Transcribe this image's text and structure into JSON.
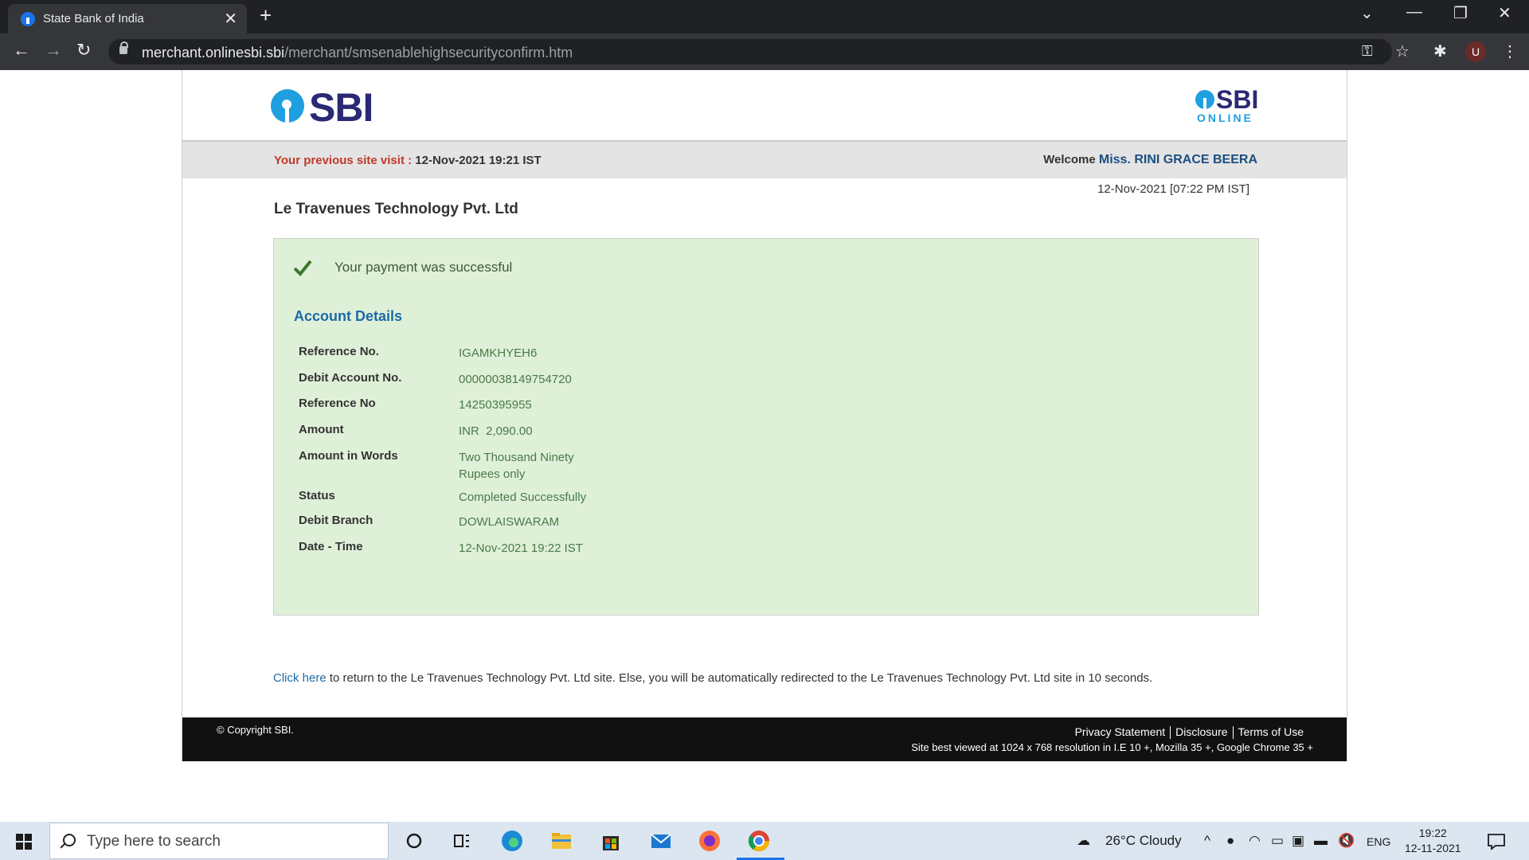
{
  "browser": {
    "tab_title": "State Bank of India",
    "url_host": "merchant.onlinesbi.sbi",
    "url_path": "/merchant/smsenablehighsecurityconfirm.htm",
    "profile_initial": "U"
  },
  "header": {
    "logo_text": "SBI",
    "online_logo_text": "SBI",
    "online_logo_sub": "ONLINE",
    "prev_visit_label": "Your previous site visit :",
    "prev_visit_value": "12-Nov-2021 19:21 IST",
    "welcome_label": "Welcome",
    "welcome_name": "Miss. RINI GRACE BEERA",
    "current_datetime": "12-Nov-2021 [07:22 PM IST]"
  },
  "merchant_name": "Le Travenues Technology Pvt. Ltd",
  "result": {
    "message": "Your payment was successful",
    "section_title": "Account Details",
    "rows": [
      {
        "label": "Reference No.",
        "value": "IGAMKHYEH6"
      },
      {
        "label": "Debit Account No.",
        "value": "00000038149754720"
      },
      {
        "label": "Reference No",
        "value": "14250395955"
      },
      {
        "label": "Amount",
        "value": "INR  2,090.00"
      },
      {
        "label": "Amount in Words",
        "value": "Two Thousand Ninety Rupees only"
      },
      {
        "label": "Status",
        "value": "Completed Successfully"
      },
      {
        "label": "Debit Branch",
        "value": "DOWLAISWARAM"
      },
      {
        "label": "Date - Time",
        "value": "12-Nov-2021 19:22 IST"
      }
    ]
  },
  "redirect": {
    "link_text": "Click here",
    "text": " to return to the Le Travenues Technology Pvt. Ltd site. Else, you will be automatically redirected to the Le Travenues Technology Pvt. Ltd site in 10 seconds."
  },
  "footer": {
    "copyright": "© Copyright SBI.",
    "links": [
      "Privacy Statement",
      "Disclosure",
      "Terms of Use"
    ],
    "best_view": "Site best viewed at 1024 x 768 resolution in I.E 10 +, Mozilla 35 +, Google Chrome 35 +"
  },
  "taskbar": {
    "search_placeholder": "Type here to search",
    "weather": "26°C  Cloudy",
    "language": "ENG",
    "time": "19:22",
    "date": "12-11-2021"
  },
  "colors": {
    "success_bg": "#dff0d8",
    "link_blue": "#1c6aa6",
    "sbi_blue": "#2a2973",
    "sbi_cyan": "#1f9fe0",
    "prev_visit_red": "#c0392b"
  }
}
